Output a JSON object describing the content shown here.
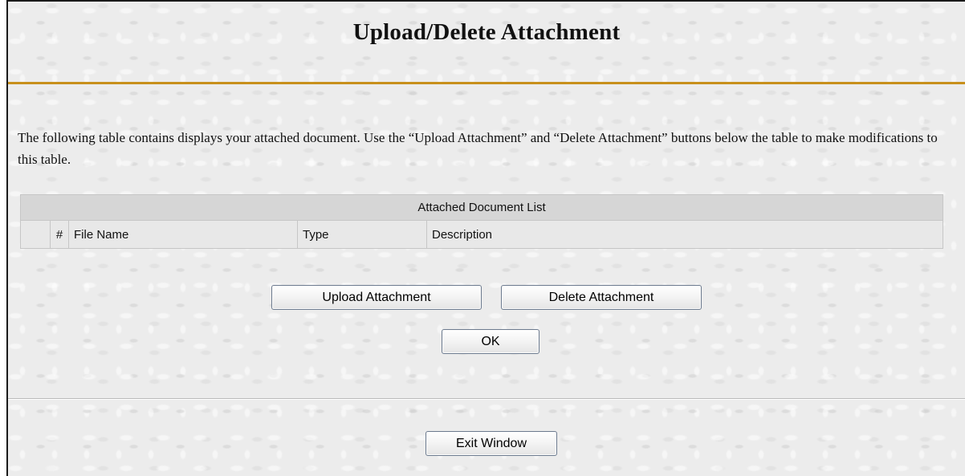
{
  "header": {
    "title": "Upload/Delete Attachment"
  },
  "intro": {
    "text": "The following table contains displays your attached document. Use the “Upload Attachment” and “Delete Attachment” buttons below the table to make modifications to this table."
  },
  "table": {
    "caption": "Attached Document List",
    "columns": {
      "select": "",
      "number": "#",
      "file_name": "File Name",
      "type": "Type",
      "description": "Description"
    },
    "rows": []
  },
  "actions": {
    "upload_label": "Upload Attachment",
    "delete_label": "Delete Attachment",
    "ok_label": "OK",
    "exit_label": "Exit Window"
  },
  "colors": {
    "accent_rule": "#c8901c",
    "background": "#ececec",
    "table_caption_bg": "#d6d6d6"
  }
}
